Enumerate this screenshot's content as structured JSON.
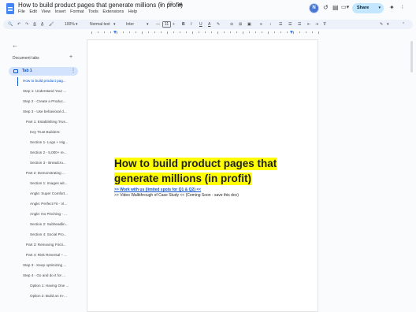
{
  "header": {
    "doc_title": "How to build product pages that generate millions (in profit)",
    "title_icons": "☆ ⛁ ☁",
    "menu": [
      "File",
      "Edit",
      "View",
      "Insert",
      "Format",
      "Tools",
      "Extensions",
      "Help"
    ],
    "avatar_letter": "N",
    "share_label": "Share",
    "share_arrow": "▾",
    "icons": {
      "history": "↺",
      "comment": "▤",
      "meet": "▭▾",
      "gemini": "✦",
      "more": "⁞"
    }
  },
  "toolbar": {
    "search": "🔍",
    "undo": "↶",
    "redo": "↷",
    "print": "⎙",
    "spellcheck": "A̲",
    "paint_format": "🖌",
    "zoom": "100%",
    "zoom_arrow": "▾",
    "style": "Normal text",
    "style_arrow": "▾",
    "font": "Inter",
    "font_arrow": "▾",
    "decrease_size": "—",
    "font_size": "11",
    "increase_size": "+",
    "bold": "B",
    "italic": "I",
    "underline": "U",
    "text_color": "A",
    "highlight": "✎",
    "link": "⊖",
    "comment": "⊞",
    "image": "▣",
    "align": "≡",
    "line_spacing": "↕",
    "checklist": "☰",
    "bullets": "☰",
    "numbers": "☰",
    "indent_less": "⇤",
    "indent_more": "⇥",
    "clear": "T̸",
    "edit_mode": "✎",
    "edit_arrow": "▾",
    "collapse": "⌃"
  },
  "sidebar": {
    "back": "←",
    "heading": "Document tabs",
    "add": "+",
    "tab_label": "Tab 1",
    "tab_more": "⋮",
    "outline": [
      {
        "text": "How to build product pag...",
        "active": true
      },
      {
        "text": "Step 1: Understand Your ...",
        "active": false
      },
      {
        "text": "Step 2 - Create a Produc...",
        "active": false
      },
      {
        "text": "Step 3 - Use behavioral d...",
        "active": false
      },
      {
        "text": "Part 1: Establishing Trus...",
        "active": false
      },
      {
        "text": "Key Trust Builders:",
        "active": false
      },
      {
        "text": "Section 1- Logo + Hig...",
        "active": false
      },
      {
        "text": "Section 2 - 5,000+ re...",
        "active": false
      },
      {
        "text": "Section 3 - Breadcru...",
        "active": false
      },
      {
        "text": "Part 2: Demonstrating ...",
        "active": false
      },
      {
        "text": "Section 1: Images wit...",
        "active": false
      },
      {
        "text": "Angle: Super Comfort...",
        "active": false
      },
      {
        "text": "Angle: Perfect Fit - Vi...",
        "active": false
      },
      {
        "text": "Angle: No Pinching - ...",
        "active": false
      },
      {
        "text": "Section 2: Subheadlin...",
        "active": false
      },
      {
        "text": "Section 4: Social Pro...",
        "active": false
      },
      {
        "text": "Part 3: Removing Fricti...",
        "active": false
      },
      {
        "text": "Part 4: Risk Reversal – ...",
        "active": false
      },
      {
        "text": "Step 3 - Keep optimizing ...",
        "active": false
      },
      {
        "text": "Step 4 - Go and do it for ...",
        "active": false
      },
      {
        "text": "Option 1: Having One ...",
        "active": false
      },
      {
        "text": "Option 2: Build an In-...",
        "active": false
      }
    ]
  },
  "document": {
    "heading_line1": "How to build product pages that",
    "heading_line2": "generate millions (in profit)",
    "link_text": ">> Work with us (limited spots for Q1 & Q2) <<",
    "body_text": ">> Video Walkthrough of Case Study << (Coming Soon - save this doc)"
  },
  "colors": {
    "accent": "#0b57d0",
    "highlight": "#ffff00",
    "share_bg": "#c2e7ff",
    "link": "#1155cc"
  }
}
